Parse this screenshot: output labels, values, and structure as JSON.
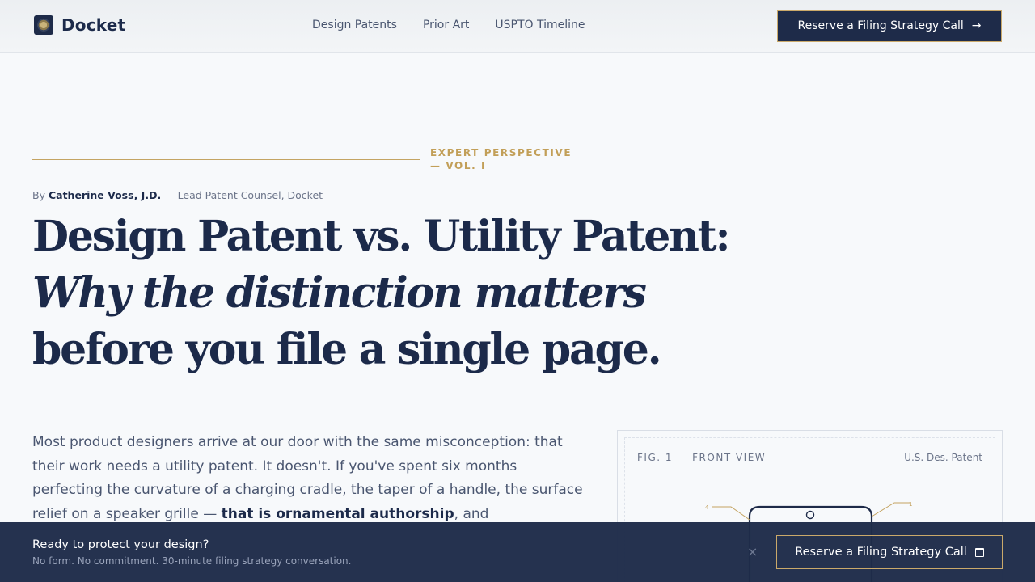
{
  "brand": {
    "name": "Docket"
  },
  "nav": {
    "items": [
      "Design Patents",
      "Prior Art",
      "USPTO Timeline"
    ]
  },
  "header_cta": {
    "label": "Reserve a Filing Strategy Call"
  },
  "eyebrow": {
    "line1": "EXPERT PERSPECTIVE",
    "line2": "— VOL. I"
  },
  "byline": {
    "prefix": "By",
    "author": "Catherine Voss, J.D.",
    "role": "— Lead Patent Counsel, Docket"
  },
  "headline": {
    "line1": "Design Patent vs. Utility Patent:",
    "line2": "Why the distinction matters",
    "line3": "before you file a single page."
  },
  "body": {
    "text1": "Most product designers arrive at our door with the same misconception: that their work needs a utility patent. It doesn't. If you've spent six months perfecting the curvature of a charging cradle, the taper of a handle, the surface relief on a speaker grille —",
    "emphasis": "that is ornamental authorship",
    "text2": ", and"
  },
  "figure": {
    "label": "FIG. 1 — FRONT VIEW",
    "reference": "U.S. Des. Patent",
    "callouts": [
      "4",
      "1"
    ]
  },
  "cta_bar": {
    "title": "Ready to protect your design?",
    "subtitle": "No form. No commitment. 30-minute filing strategy conversation.",
    "close": "×",
    "button": "Reserve a Filing Strategy Call"
  },
  "colors": {
    "navy": "#1e2b49",
    "gold": "#c4a462",
    "background": "#f7f9fb"
  },
  "icons": [
    "crest-logo-icon",
    "arrow-right-icon",
    "close-icon",
    "calendar-icon"
  ]
}
